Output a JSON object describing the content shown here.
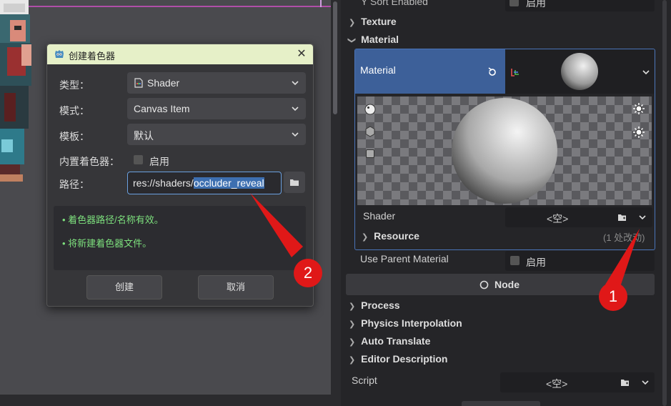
{
  "dialog": {
    "title": "创建着色器",
    "rows": {
      "type_label": "类型：",
      "type_value": "Shader",
      "mode_label": "模式：",
      "mode_value": "Canvas Item",
      "template_label": "模板：",
      "template_value": "默认",
      "builtin_label": "内置着色器：",
      "builtin_value": "启用",
      "path_label": "路径：",
      "path_prefix": "res://shaders/",
      "path_selected": "occluder_reveal"
    },
    "messages": [
      "着色器路径/名称有效。",
      "将新建着色器文件。"
    ],
    "create_button": "创建",
    "cancel_button": "取消"
  },
  "inspector": {
    "sort_enabled_label": "Y Sort Enabled",
    "sort_enabled_value": "启用",
    "texture_section": "Texture",
    "material_section": "Material",
    "material_label": "Material",
    "shader_label": "Shader",
    "shader_value": "<空>",
    "resource_label": "Resource",
    "resource_changes": "(1 处改动)",
    "use_parent_label": "Use Parent Material",
    "use_parent_value": "启用",
    "node_header": "Node",
    "sections": [
      "Process",
      "Physics Interpolation",
      "Auto Translate",
      "Editor Description"
    ],
    "script_label": "Script",
    "script_value": "<空>"
  },
  "annotations": [
    "1",
    "2"
  ],
  "colors": {
    "accent": "#3d6099",
    "selection": "#3d6fb0",
    "success_text": "#7de07d",
    "annotation": "#e01818",
    "title_bar": "#e6f0c8"
  }
}
